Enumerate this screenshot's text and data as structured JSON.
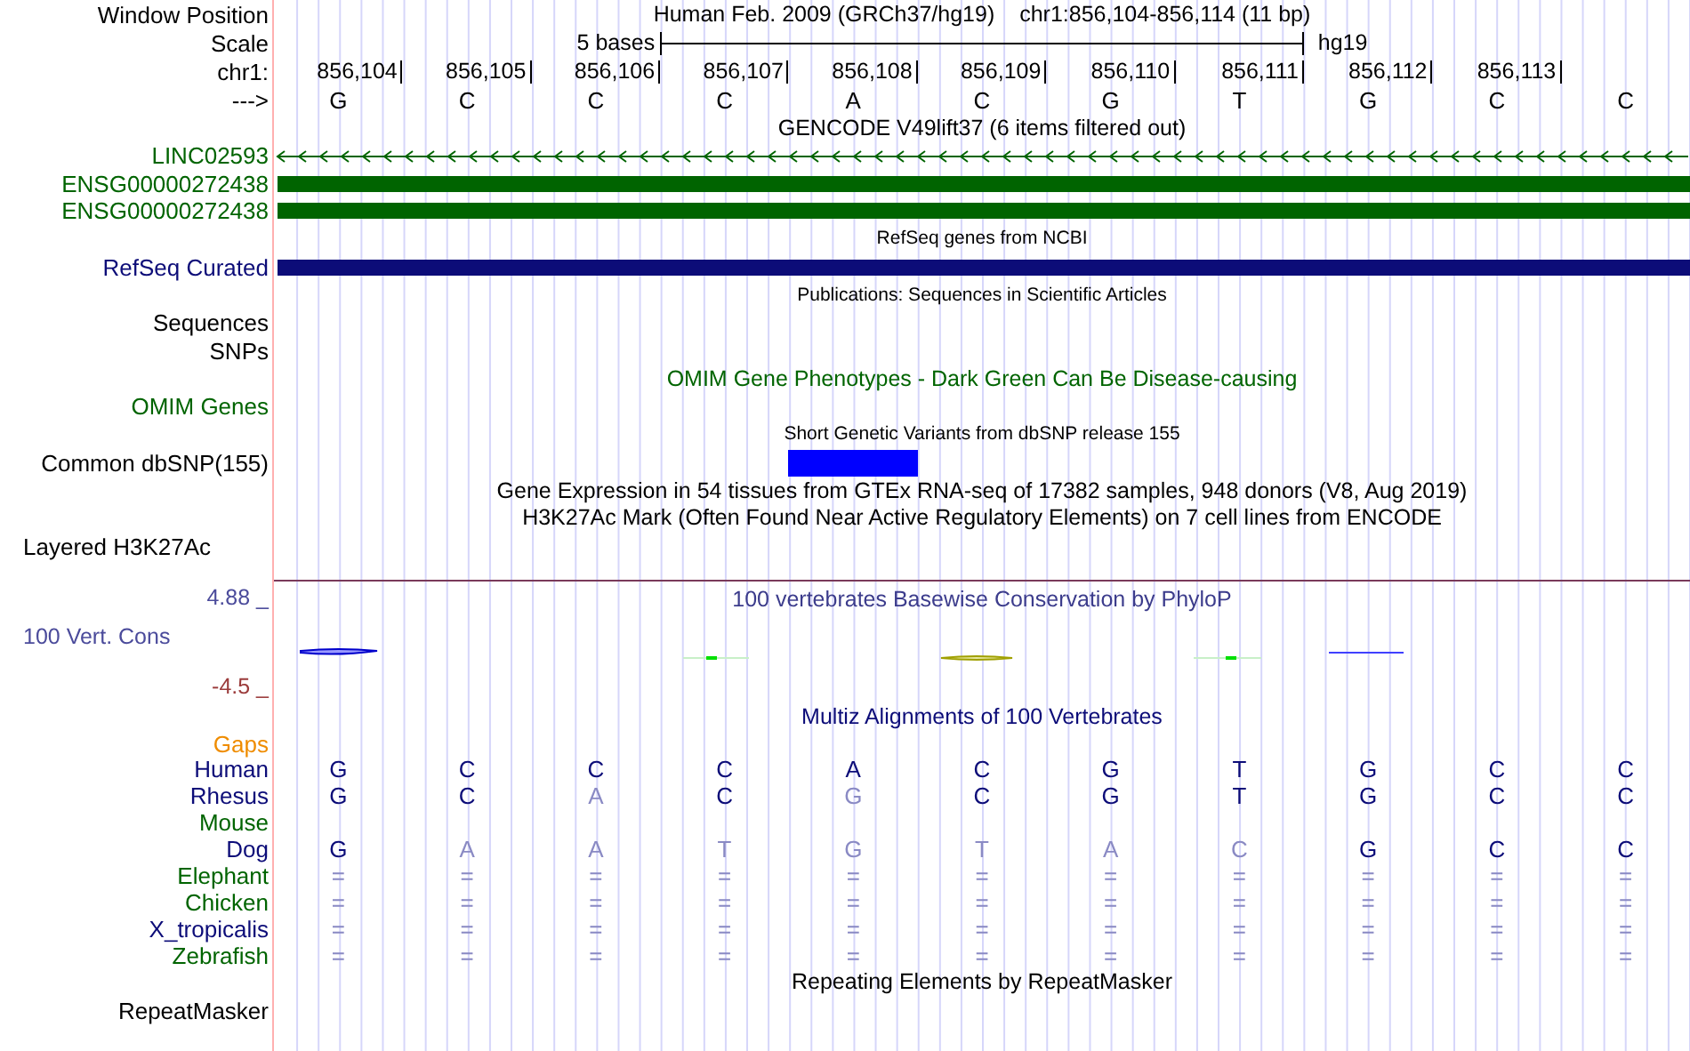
{
  "header": {
    "position_label": "Window Position",
    "title": "Human Feb. 2009 (GRCh37/hg19)",
    "location": "chr1:856,104-856,114 (11 bp)",
    "scale_label": "Scale",
    "scale_text": "5 bases",
    "assembly": "hg19",
    "chrom_label": "chr1:",
    "positions": [
      "856,104",
      "856,105",
      "856,106",
      "856,107",
      "856,108",
      "856,109",
      "856,110",
      "856,111",
      "856,112",
      "856,113"
    ],
    "strand_label": "--->",
    "bases": [
      "G",
      "C",
      "C",
      "C",
      "A",
      "C",
      "G",
      "T",
      "G",
      "C",
      "C"
    ]
  },
  "tracks": [
    {
      "kind": "center_title",
      "text": "GENCODE V49lift37 (6 items filtered out)",
      "color": "#000000"
    },
    {
      "kind": "gene_line",
      "label": "LINC02593",
      "color": "#006400"
    },
    {
      "kind": "gene_bar",
      "label": "ENSG00000272438",
      "color": "#006400"
    },
    {
      "kind": "gene_bar",
      "label": "ENSG00000272438",
      "color": "#006400"
    },
    {
      "kind": "small_title",
      "text": "RefSeq genes from NCBI"
    },
    {
      "kind": "gene_bar",
      "label": "RefSeq Curated",
      "color": "#0c0c78"
    },
    {
      "kind": "small_title",
      "text": "Publications: Sequences in Scientific Articles"
    },
    {
      "kind": "label",
      "label": "Sequences",
      "color": "#000000"
    },
    {
      "kind": "label",
      "label": "SNPs",
      "color": "#000000"
    },
    {
      "kind": "center_title",
      "text": "OMIM Gene Phenotypes - Dark Green Can Be Disease-causing",
      "color": "#006400"
    },
    {
      "kind": "label",
      "label": "OMIM Genes",
      "color": "#006400"
    },
    {
      "kind": "small_title",
      "text": "Short Genetic Variants from dbSNP release 155"
    },
    {
      "kind": "variant_block",
      "label": "Common dbSNP(155)",
      "color": "#000000",
      "covered": [
        false,
        false,
        false,
        false,
        true,
        false,
        false,
        false,
        false,
        false,
        false
      ]
    },
    {
      "kind": "center_title",
      "text": "Gene Expression in 54 tissues from GTEx RNA-seq of 17382 samples, 948 donors (V8, Aug 2019)",
      "color": "#000000"
    },
    {
      "kind": "center_title",
      "text": "H3K27Ac Mark (Often Found Near Active Regulatory Elements) on 7 cell lines from ENCODE",
      "color": "#000000"
    },
    {
      "kind": "left_label",
      "label": "Layered H3K27Ac",
      "color": "#000000"
    }
  ],
  "conservation": {
    "max_label": "4.88 _",
    "label": "100 Vert. Cons",
    "min_label": "-4.5 _",
    "title": "100 vertebrates Basewise Conservation by PhyloP"
  },
  "alignment": {
    "title": "Multiz Alignments of 100 Vertebrates",
    "gaps_label": "Gaps",
    "species": [
      {
        "name": "Human",
        "color": "#0c0c78",
        "bases": [
          {
            "base": "G",
            "conserved": true
          },
          {
            "base": "C",
            "conserved": true
          },
          {
            "base": "C",
            "conserved": true
          },
          {
            "base": "C",
            "conserved": true
          },
          {
            "base": "A",
            "conserved": true
          },
          {
            "base": "C",
            "conserved": true
          },
          {
            "base": "G",
            "conserved": true
          },
          {
            "base": "T",
            "conserved": true
          },
          {
            "base": "G",
            "conserved": true
          },
          {
            "base": "C",
            "conserved": true
          },
          {
            "base": "C",
            "conserved": true
          }
        ]
      },
      {
        "name": "Rhesus",
        "color": "#0c0c78",
        "bases": [
          {
            "base": "G",
            "conserved": true
          },
          {
            "base": "C",
            "conserved": true
          },
          {
            "base": "A",
            "conserved": false
          },
          {
            "base": "C",
            "conserved": true
          },
          {
            "base": "G",
            "conserved": false
          },
          {
            "base": "C",
            "conserved": true
          },
          {
            "base": "G",
            "conserved": true
          },
          {
            "base": "T",
            "conserved": true
          },
          {
            "base": "G",
            "conserved": true
          },
          {
            "base": "C",
            "conserved": true
          },
          {
            "base": "C",
            "conserved": true
          }
        ]
      },
      {
        "name": "Mouse",
        "color": "#006400"
      },
      {
        "name": "Dog",
        "color": "#0c0c78",
        "bases": [
          {
            "base": "G",
            "conserved": true
          },
          {
            "base": "A",
            "conserved": false
          },
          {
            "base": "A",
            "conserved": false
          },
          {
            "base": "T",
            "conserved": false
          },
          {
            "base": "G",
            "conserved": false
          },
          {
            "base": "T",
            "conserved": false
          },
          {
            "base": "A",
            "conserved": false
          },
          {
            "base": "C",
            "conserved": false
          },
          {
            "base": "G",
            "conserved": true
          },
          {
            "base": "C",
            "conserved": true
          },
          {
            "base": "C",
            "conserved": true
          }
        ]
      },
      {
        "name": "Elephant",
        "color": "#006400",
        "bases": [
          {
            "base": "=",
            "conserved": false
          },
          {
            "base": "=",
            "conserved": false
          },
          {
            "base": "=",
            "conserved": false
          },
          {
            "base": "=",
            "conserved": false
          },
          {
            "base": "=",
            "conserved": false
          },
          {
            "base": "=",
            "conserved": false
          },
          {
            "base": "=",
            "conserved": false
          },
          {
            "base": "=",
            "conserved": false
          },
          {
            "base": "=",
            "conserved": false
          },
          {
            "base": "=",
            "conserved": false
          },
          {
            "base": "=",
            "conserved": false
          }
        ]
      },
      {
        "name": "Chicken",
        "color": "#006400",
        "bases": [
          {
            "base": "=",
            "conserved": false
          },
          {
            "base": "=",
            "conserved": false
          },
          {
            "base": "=",
            "conserved": false
          },
          {
            "base": "=",
            "conserved": false
          },
          {
            "base": "=",
            "conserved": false
          },
          {
            "base": "=",
            "conserved": false
          },
          {
            "base": "=",
            "conserved": false
          },
          {
            "base": "=",
            "conserved": false
          },
          {
            "base": "=",
            "conserved": false
          },
          {
            "base": "=",
            "conserved": false
          },
          {
            "base": "=",
            "conserved": false
          }
        ]
      },
      {
        "name": "X_tropicalis",
        "color": "#0c0c78",
        "bases": [
          {
            "base": "=",
            "conserved": false
          },
          {
            "base": "=",
            "conserved": false
          },
          {
            "base": "=",
            "conserved": false
          },
          {
            "base": "=",
            "conserved": false
          },
          {
            "base": "=",
            "conserved": false
          },
          {
            "base": "=",
            "conserved": false
          },
          {
            "base": "=",
            "conserved": false
          },
          {
            "base": "=",
            "conserved": false
          },
          {
            "base": "=",
            "conserved": false
          },
          {
            "base": "=",
            "conserved": false
          },
          {
            "base": "=",
            "conserved": false
          }
        ]
      },
      {
        "name": "Zebrafish",
        "color": "#006400",
        "bases": [
          {
            "base": "=",
            "conserved": false
          },
          {
            "base": "=",
            "conserved": false
          },
          {
            "base": "=",
            "conserved": false
          },
          {
            "base": "=",
            "conserved": false
          },
          {
            "base": "=",
            "conserved": false
          },
          {
            "base": "=",
            "conserved": false
          },
          {
            "base": "=",
            "conserved": false
          },
          {
            "base": "=",
            "conserved": false
          },
          {
            "base": "=",
            "conserved": false
          },
          {
            "base": "=",
            "conserved": false
          },
          {
            "base": "=",
            "conserved": false
          }
        ]
      }
    ]
  },
  "repeats": {
    "title": "Repeating Elements by RepeatMasker",
    "label": "RepeatMasker"
  }
}
